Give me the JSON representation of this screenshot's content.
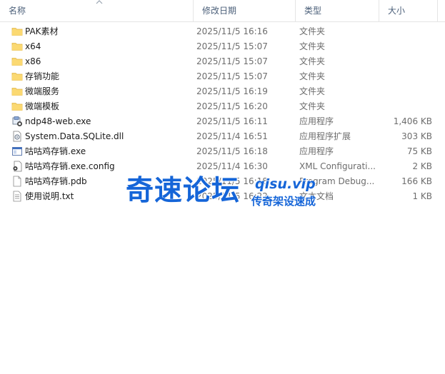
{
  "columns": {
    "name": "名称",
    "date": "修改日期",
    "type": "类型",
    "size": "大小"
  },
  "files": [
    {
      "icon": "folder-icon",
      "name": "PAK素材",
      "date": "2025/11/5 16:16",
      "type": "文件夹",
      "size": ""
    },
    {
      "icon": "folder-icon",
      "name": "x64",
      "date": "2025/11/5 15:07",
      "type": "文件夹",
      "size": ""
    },
    {
      "icon": "folder-icon",
      "name": "x86",
      "date": "2025/11/5 15:07",
      "type": "文件夹",
      "size": ""
    },
    {
      "icon": "folder-icon",
      "name": "存销功能",
      "date": "2025/11/5 15:07",
      "type": "文件夹",
      "size": ""
    },
    {
      "icon": "folder-icon",
      "name": "微端服务",
      "date": "2025/11/5 16:19",
      "type": "文件夹",
      "size": ""
    },
    {
      "icon": "folder-icon",
      "name": "微端模板",
      "date": "2025/11/5 16:20",
      "type": "文件夹",
      "size": ""
    },
    {
      "icon": "installer-icon",
      "name": "ndp48-web.exe",
      "date": "2025/11/5 16:11",
      "type": "应用程序",
      "size": "1,406 KB"
    },
    {
      "icon": "dll-icon",
      "name": "System.Data.SQLite.dll",
      "date": "2025/11/4 16:51",
      "type": "应用程序扩展",
      "size": "303 KB"
    },
    {
      "icon": "app-window-icon",
      "name": "咕咕鸡存销.exe",
      "date": "2025/11/5 16:18",
      "type": "应用程序",
      "size": "75 KB"
    },
    {
      "icon": "config-file-icon",
      "name": "咕咕鸡存销.exe.config",
      "date": "2025/11/4 16:30",
      "type": "XML Configurati...",
      "size": "2 KB"
    },
    {
      "icon": "blank-file-icon",
      "name": "咕咕鸡存销.pdb",
      "date": "2025/11/5 16:18",
      "type": "Program Debug...",
      "size": "166 KB"
    },
    {
      "icon": "text-file-icon",
      "name": "使用说明.txt",
      "date": "2025/11/5 16:22",
      "type": "文本文档",
      "size": "1 KB"
    }
  ],
  "watermark": {
    "main": "奇速论坛",
    "site": "qisu.vip",
    "slogan": "传奇架设速成"
  },
  "colors": {
    "folder": "#f8d775",
    "watermark": "#1565d8",
    "header_text": "#4c607a"
  }
}
